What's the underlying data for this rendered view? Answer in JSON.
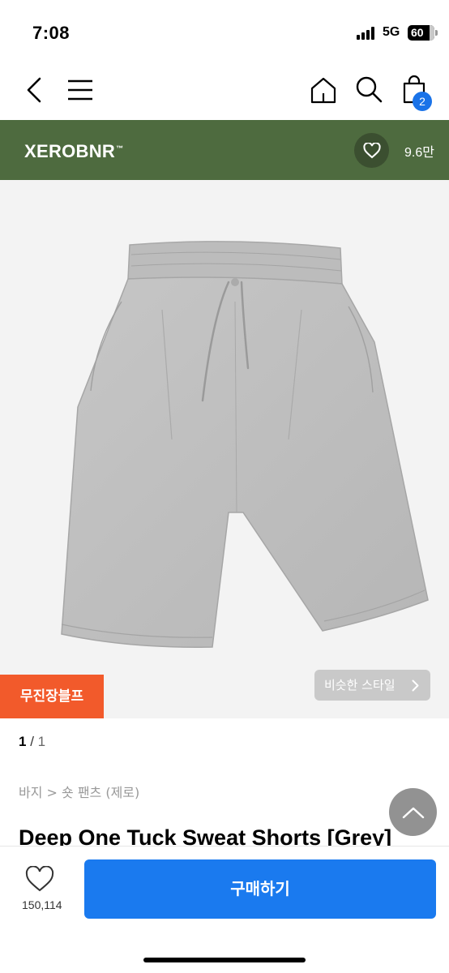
{
  "status_bar": {
    "time": "7:08",
    "network": "5G",
    "battery": "60"
  },
  "nav": {
    "icons": [
      "back-icon",
      "menu-icon",
      "home-icon",
      "search-icon",
      "cart-icon"
    ],
    "cart_count": "2"
  },
  "brand": {
    "name": "XEROBNR",
    "tm": "™",
    "like_count": "9.6만",
    "color": "#4e6b3f"
  },
  "product_image": {
    "description_icon": "grey-sweat-shorts-image"
  },
  "badges": {
    "free_shipping": "무진장블프",
    "similar_style": "비슷한 스타일"
  },
  "pager": {
    "current": "1",
    "separator": " / ",
    "total": "1"
  },
  "breadcrumb": "바지 > 숏 팬츠 (제로)",
  "product": {
    "title": "Deep One Tuck Sweat Shorts [Grey]"
  },
  "bottom": {
    "like_count": "150,114",
    "buy_label": "구매하기",
    "accent": "#1a7aef"
  }
}
